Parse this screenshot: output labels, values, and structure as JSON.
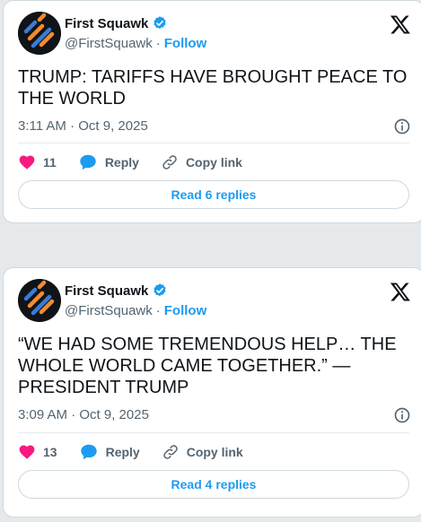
{
  "posts": [
    {
      "author": {
        "name": "First Squawk",
        "handle": "@FirstSquawk",
        "follow_label": "Follow"
      },
      "text": "TRUMP: TARIFFS HAVE BROUGHT PEACE TO THE WORLD",
      "time": "3:11 AM · Oct 9, 2025",
      "likes": "11",
      "reply_label": "Reply",
      "copy_label": "Copy link",
      "read_replies": "Read 6 replies"
    },
    {
      "author": {
        "name": "First Squawk",
        "handle": "@FirstSquawk",
        "follow_label": "Follow"
      },
      "text": "“WE HAD SOME TREMENDOUS HELP… THE WHOLE WORLD CAME TOGETHER.” — PRESIDENT TRUMP",
      "time": "3:09 AM · Oct 9, 2025",
      "likes": "13",
      "reply_label": "Reply",
      "copy_label": "Copy link",
      "read_replies": "Read 4 replies"
    }
  ],
  "colors": {
    "accent": "#1d9bf0",
    "like": "#f91880",
    "logo_orange": "#f28b30",
    "logo_blue": "#3a7bd5"
  },
  "icons": [
    "avatar-logo",
    "verified-badge-icon",
    "x-logo-icon",
    "info-icon",
    "heart-icon",
    "reply-bubble-icon",
    "link-icon"
  ]
}
